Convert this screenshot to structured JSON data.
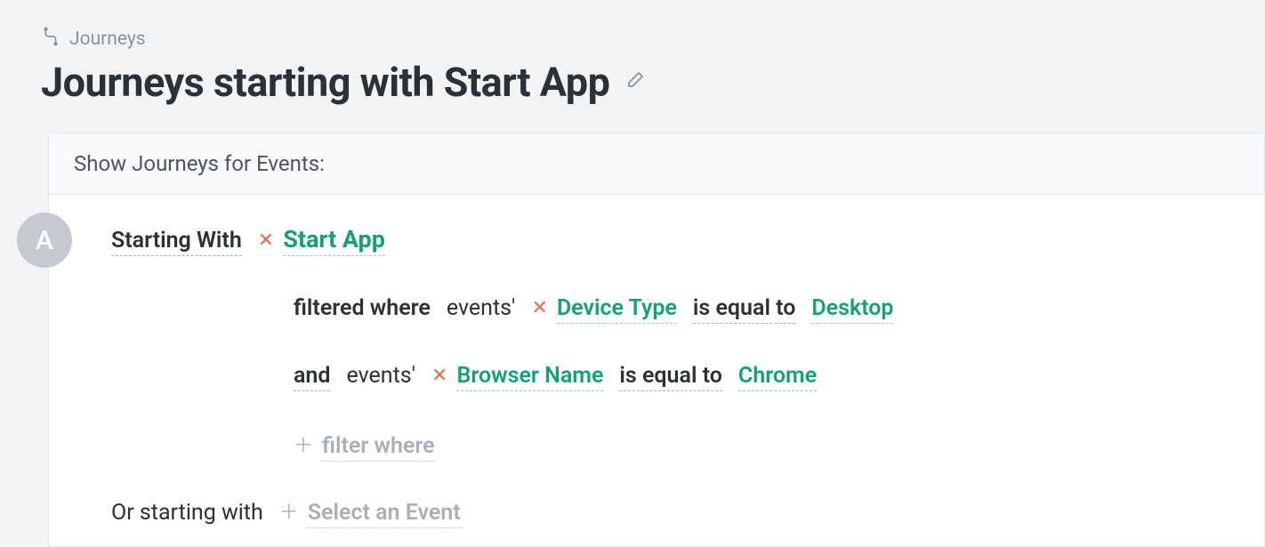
{
  "breadcrumb": {
    "label": "Journeys"
  },
  "title": "Journeys starting with Start App",
  "card": {
    "header": "Show Journeys for Events:",
    "avatar": "A",
    "starting_with_label": "Starting With",
    "event_name": "Start App",
    "filter1": {
      "prefix": "filtered where",
      "scope": "events'",
      "property": "Device Type",
      "operator": "is equal to",
      "value": "Desktop"
    },
    "filter2": {
      "conjunction": "and",
      "scope": "events'",
      "property": "Browser Name",
      "operator": "is equal to",
      "value": "Chrome"
    },
    "filter_add_label": "filter where",
    "or_label": "Or starting with",
    "or_placeholder": "Select an Event"
  }
}
